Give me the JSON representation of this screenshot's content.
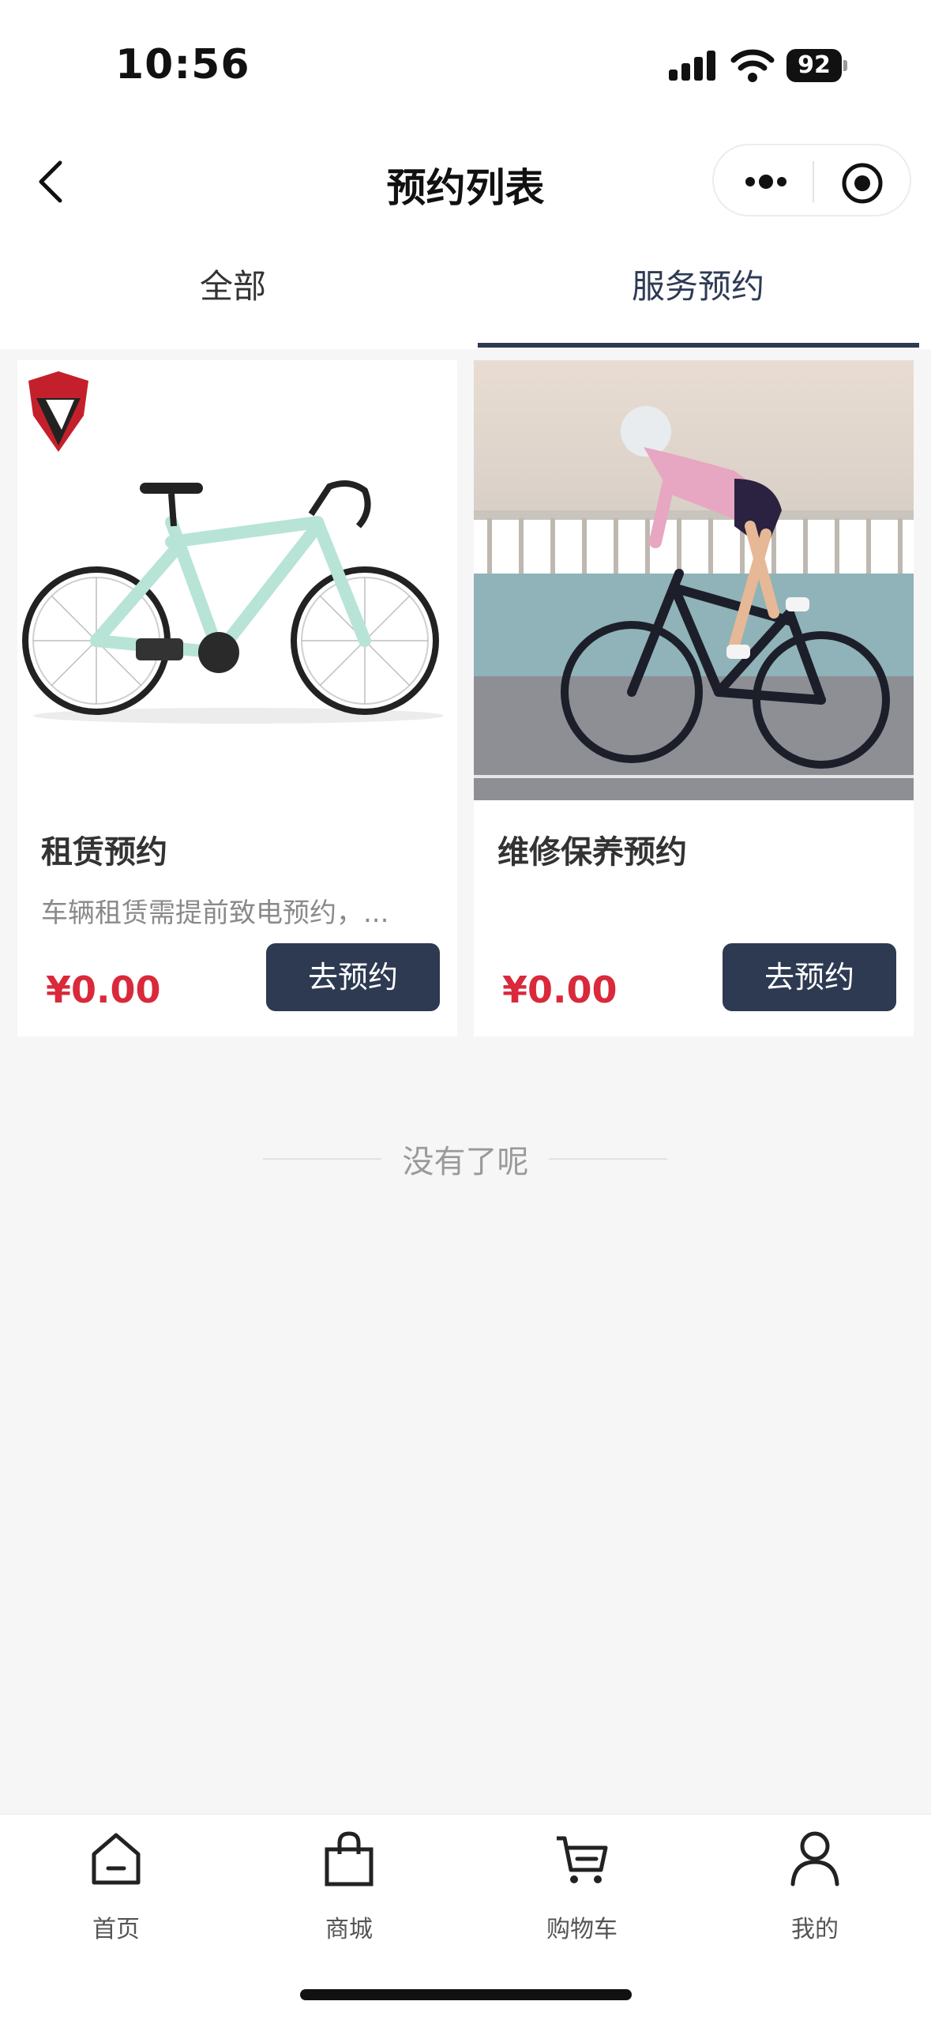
{
  "status_bar": {
    "time": "10:56",
    "battery": "92"
  },
  "nav": {
    "title": "预约列表"
  },
  "tabs": [
    {
      "label": "全部",
      "active": false
    },
    {
      "label": "服务预约",
      "active": true
    }
  ],
  "cards": [
    {
      "name": "租赁预约",
      "description": "车辆租赁需提前致电预约，...",
      "price": "¥0.00",
      "button": "去预约",
      "image": "mint-road-bike-with-logo"
    },
    {
      "name": "维修保养预约",
      "description": "",
      "price": "¥0.00",
      "button": "去预约",
      "image": "cyclist-riding-road-bike"
    }
  ],
  "end_text": "没有了呢",
  "tabbar": [
    {
      "label": "首页",
      "icon": "home-icon"
    },
    {
      "label": "商城",
      "icon": "shopping-bag-icon"
    },
    {
      "label": "购物车",
      "icon": "cart-icon"
    },
    {
      "label": "我的",
      "icon": "user-icon"
    }
  ],
  "colors": {
    "accent": "#2e3a52",
    "price": "#d9293a",
    "background": "#f6f6f6"
  }
}
